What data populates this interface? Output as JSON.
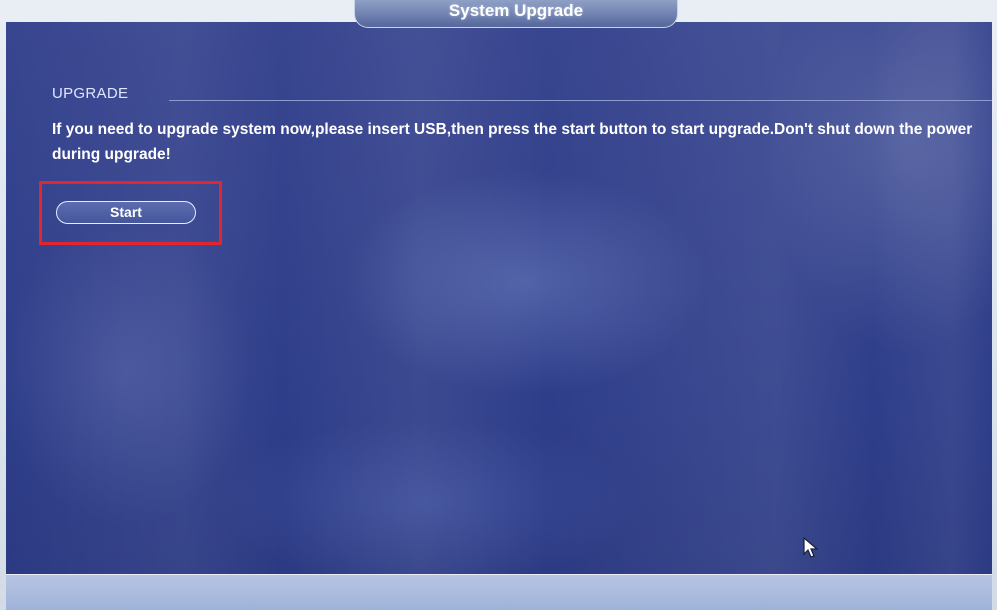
{
  "window": {
    "title": "System Upgrade"
  },
  "section": {
    "label": "UPGRADE"
  },
  "message": {
    "text": "If you need to upgrade system now,please insert USB,then press the start button to start upgrade.Don't shut down the power during upgrade!"
  },
  "buttons": {
    "start_label": "Start"
  },
  "annotation": {
    "highlight_color": "#e2252f"
  },
  "icons": {
    "cursor": "mouse-pointer-icon"
  },
  "colors": {
    "background": "#34428d",
    "text": "#ffffff"
  }
}
